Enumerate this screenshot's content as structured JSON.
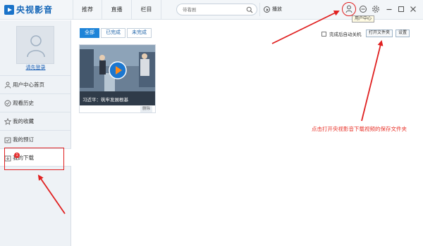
{
  "header": {
    "logo_text": "央视影音",
    "tabs": [
      "推荐",
      "直播",
      "栏目"
    ],
    "search": {
      "placeholder": "带看剧"
    },
    "play_label": "播放",
    "icons": [
      "user-icon",
      "message-icon",
      "gear-icon",
      "minimize-icon",
      "maximize-icon",
      "close-icon"
    ],
    "tooltip": "用户中心"
  },
  "sidebar": {
    "login_label": "请先登录",
    "items": [
      {
        "label": "用户中心首页",
        "icon": "user-icon"
      },
      {
        "label": "观看历史",
        "icon": "history-icon"
      },
      {
        "label": "我的收藏",
        "icon": "star-icon"
      },
      {
        "label": "我的预订",
        "icon": "calendar-icon"
      },
      {
        "label": "我的下载",
        "icon": "download-icon",
        "badge": "1",
        "active": true
      }
    ]
  },
  "main": {
    "filters": [
      {
        "label": "全部",
        "active": true
      },
      {
        "label": "已完成",
        "active": false
      },
      {
        "label": "未完成",
        "active": false
      }
    ],
    "auto_shutdown_label": "完成后自动关机",
    "open_folder_label": "打开文件夹",
    "settings_label": "设置",
    "video": {
      "title": "习近平：筑牢发展根基",
      "delete_label": "删除"
    }
  },
  "annotation": {
    "instruction": "点击打开央视影音下载视频的保存文件夹",
    "color": "#e02020"
  }
}
